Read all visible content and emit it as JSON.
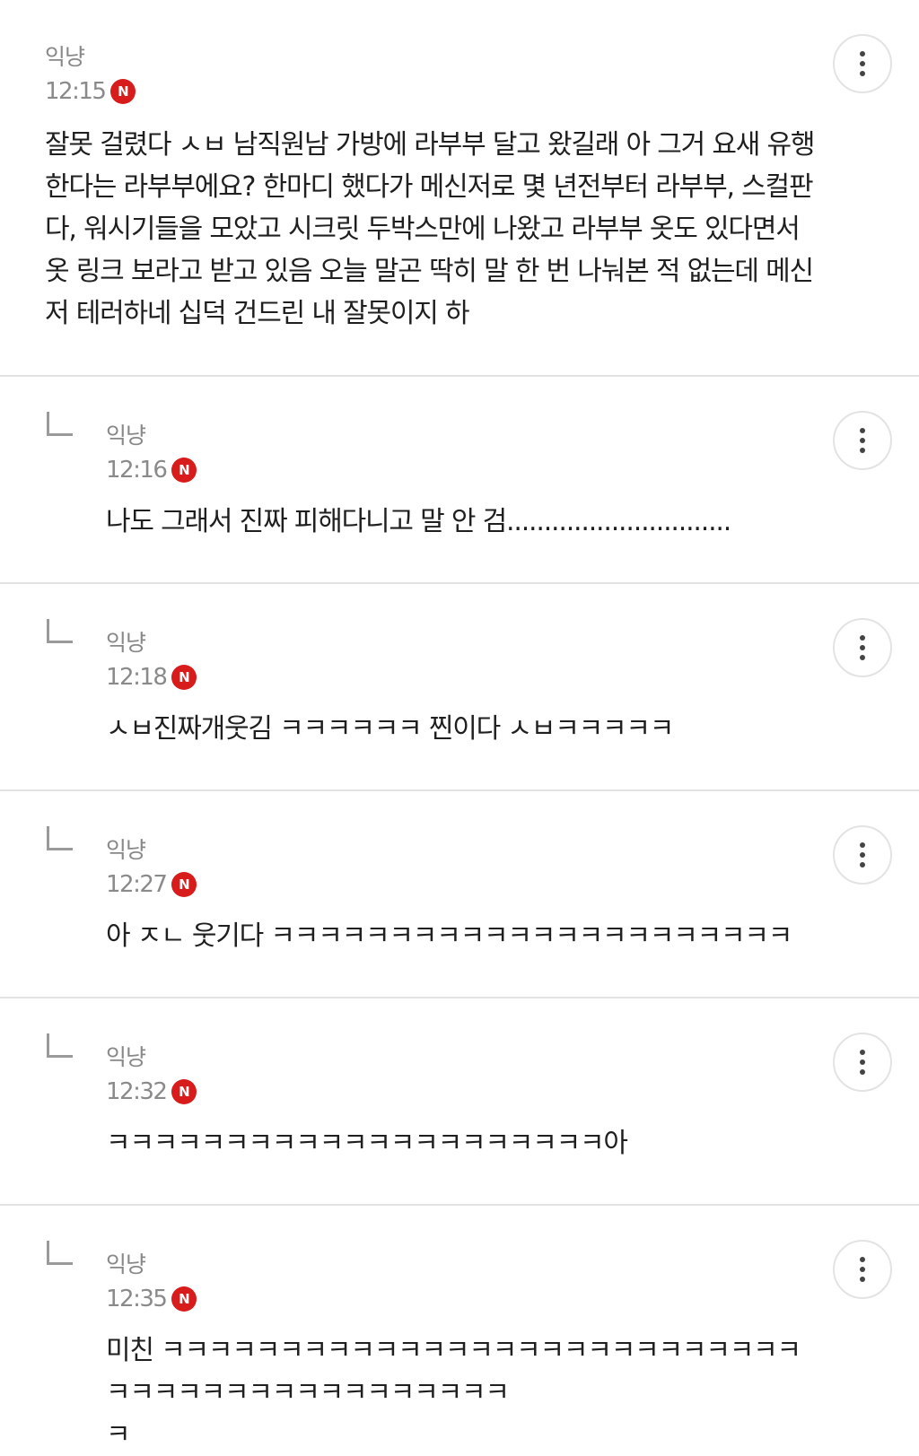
{
  "colors": {
    "new_badge": "#d81b1b",
    "divider": "#e2e2e2",
    "meta_text": "#8a8a8a",
    "body_text": "#1f1f1f"
  },
  "comments": [
    {
      "author": "익냥",
      "time": "12:15",
      "badge": "N",
      "text": "잘못 걸렸다 ㅅㅂ 남직원남 가방에 라부부 달고 왔길래 아 그거 요새 유행한다는 라부부에요? 한마디 했다가 메신저로 몇 년전부터 라부부, 스컬판다, 워시기들을 모았고 시크릿 두박스만에 나왔고 라부부 옷도 있다면서 옷 링크 보라고 받고 있음 오늘 말곤 딱히 말 한 번 나눠본 적 없는데 메신저 테러하네 십덕 건드린 내 잘못이지 하",
      "more_icon": "more-vertical-icon"
    },
    {
      "author": "익냥",
      "time": "12:16",
      "badge": "N",
      "text": "나도 그래서 진짜 피해다니고 말 안 검..............................",
      "more_icon": "more-vertical-icon",
      "reply_icon": "reply-arrow-icon"
    },
    {
      "author": "익냥",
      "time": "12:18",
      "badge": "N",
      "text": "ㅅㅂ진짜개웃김 ㅋㅋㅋㅋㅋㅋ 찐이다 ㅅㅂㅋㅋㅋㅋㅋ",
      "more_icon": "more-vertical-icon",
      "reply_icon": "reply-arrow-icon"
    },
    {
      "author": "익냥",
      "time": "12:27",
      "badge": "N",
      "text": "아 ㅈㄴ 웃기다 ㅋㅋㅋㅋㅋㅋㅋㅋㅋㅋㅋㅋㅋㅋㅋㅋㅋㅋㅋㅋㅋㅋ",
      "more_icon": "more-vertical-icon",
      "reply_icon": "reply-arrow-icon"
    },
    {
      "author": "익냥",
      "time": "12:32",
      "badge": "N",
      "text": "ㅋㅋㅋㅋㅋㅋㅋㅋㅋㅋㅋㅋㅋㅋㅋㅋㅋㅋㅋㅋㅋ아",
      "more_icon": "more-vertical-icon",
      "reply_icon": "reply-arrow-icon"
    },
    {
      "author": "익냥",
      "time": "12:35",
      "badge": "N",
      "text": "미친 ㅋㅋㅋㅋㅋㅋㅋㅋㅋㅋㅋㅋㅋㅋㅋㅋㅋㅋㅋㅋㅋㅋㅋㅋㅋㅋㅋㅋㅋㅋㅋㅋㅋㅋㅋㅋㅋㅋㅋㅋㅋㅋㅋㅋ\nㅋ",
      "more_icon": "more-vertical-icon",
      "reply_icon": "reply-arrow-icon"
    }
  ]
}
